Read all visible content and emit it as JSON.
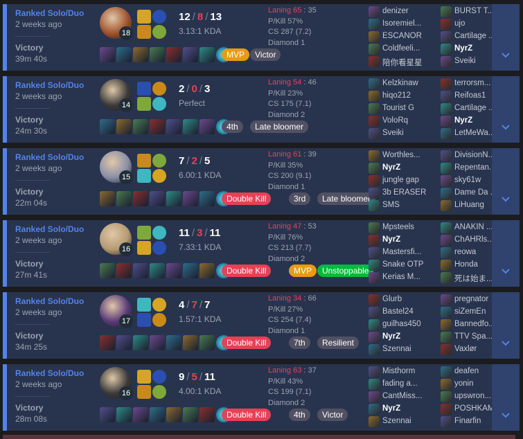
{
  "matches": [
    {
      "mode": "Ranked Solo/Duo",
      "ago": "2 weeks ago",
      "result": "Victory",
      "duration": "39m 40s",
      "level": "18",
      "kills": "12",
      "deaths": "8",
      "assists": "13",
      "ratio": "3.13:1 KDA",
      "laning_label": "Laning",
      "laning_a": "65",
      "laning_b": "35",
      "pkill": "P/Kill 57%",
      "cs": "CS 287 (7.2)",
      "rank": "Diamond 1",
      "badges": [
        {
          "label": "MVP",
          "style": "mvp"
        },
        {
          "label": "Victor",
          "style": "gray"
        }
      ],
      "team1": [
        "denizer",
        "Isoremiel...",
        "ESCANOR",
        "Coldfeeli...",
        "陪你看星星"
      ],
      "team2": [
        "BURST T...",
        "ujo",
        "Cartilage ...",
        "NyrZ",
        "Sveiki"
      ],
      "me_team": 2,
      "me_index": 3,
      "champ_color": "#a0522d"
    },
    {
      "mode": "Ranked Solo/Duo",
      "ago": "2 weeks ago",
      "result": "Victory",
      "duration": "24m 30s",
      "level": "14",
      "kills": "2",
      "deaths": "0",
      "assists": "3",
      "ratio": "Perfect",
      "laning_label": "Laning",
      "laning_a": "54",
      "laning_b": "46",
      "pkill": "P/Kill 23%",
      "cs": "CS 175 (7.1)",
      "rank": "Diamond 2",
      "badges": [
        {
          "label": "4th",
          "style": "gray"
        },
        {
          "label": "Late bloomer",
          "style": "gray"
        }
      ],
      "team1": [
        "Kelzkinaw",
        "hiqo212",
        "Tourist G",
        "VoloRq",
        "Sveiki"
      ],
      "team2": [
        "terrorsm...",
        "Reifoas1",
        "Cartilage ...",
        "NyrZ",
        "LetMeWa..."
      ],
      "me_team": 2,
      "me_index": 3,
      "champ_color": "#3a3a3a"
    },
    {
      "mode": "Ranked Solo/Duo",
      "ago": "2 weeks ago",
      "result": "Victory",
      "duration": "22m 04s",
      "level": "15",
      "kills": "7",
      "deaths": "2",
      "assists": "5",
      "ratio": "6.00:1 KDA",
      "laning_label": "Laning",
      "laning_a": "61",
      "laning_b": "39",
      "pkill": "P/Kill 35%",
      "cs": "CS 200 (9.1)",
      "rank": "Diamond 1",
      "badges": [
        {
          "label": "Double Kill",
          "style": "red"
        },
        {
          "label": "3rd",
          "style": "gray"
        },
        {
          "label": "Late bloomer",
          "style": "gray"
        }
      ],
      "team1": [
        "Worthles...",
        "NyrZ",
        "jungle gap",
        "3b ERASER",
        "SMS"
      ],
      "team2": [
        "DivisionN...",
        "Repentan...",
        "sky61w",
        "Dame Da ...",
        "LiHuang"
      ],
      "me_team": 1,
      "me_index": 1,
      "champ_color": "#8a8fa8"
    },
    {
      "mode": "Ranked Solo/Duo",
      "ago": "2 weeks ago",
      "result": "Victory",
      "duration": "27m 41s",
      "level": "16",
      "kills": "11",
      "deaths": "3",
      "assists": "11",
      "ratio": "7.33:1 KDA",
      "laning_label": "Laning",
      "laning_a": "47",
      "laning_b": "53",
      "pkill": "P/Kill 76%",
      "cs": "CS 213 (7.7)",
      "rank": "Diamond 2",
      "badges": [
        {
          "label": "Double Kill",
          "style": "red"
        },
        {
          "label": "MVP",
          "style": "mvp"
        },
        {
          "label": "Unstoppable",
          "style": "green"
        }
      ],
      "team1": [
        "Mpsteels",
        "NyrZ",
        "Mastersfi...",
        "Snake OTP",
        "Kerias M..."
      ],
      "team2": [
        "ANAKIN ...",
        "ChAHRls...",
        "reowa",
        "Honda",
        "死は始ま..."
      ],
      "me_team": 1,
      "me_index": 1,
      "champ_color": "#b59a72"
    },
    {
      "mode": "Ranked Solo/Duo",
      "ago": "2 weeks ago",
      "result": "Victory",
      "duration": "34m 25s",
      "level": "17",
      "kills": "4",
      "deaths": "7",
      "assists": "7",
      "ratio": "1.57:1 KDA",
      "laning_label": "Laning",
      "laning_a": "34",
      "laning_b": "66",
      "pkill": "P/Kill 27%",
      "cs": "CS 254 (7.4)",
      "rank": "Diamond 1",
      "badges": [
        {
          "label": "Double Kill",
          "style": "red"
        },
        {
          "label": "7th",
          "style": "gray"
        },
        {
          "label": "Resilient",
          "style": "gray"
        }
      ],
      "team1": [
        "Glurb",
        "Bastel24",
        "guilhas450",
        "NyrZ",
        "Szennai"
      ],
      "team2": [
        "pregnator",
        "siZemEn",
        "Bannedfo...",
        "TTV Spa...",
        "Vaxlør"
      ],
      "me_team": 1,
      "me_index": 3,
      "champ_color": "#5a3a78"
    },
    {
      "mode": "Ranked Solo/Duo",
      "ago": "2 weeks ago",
      "result": "Victory",
      "duration": "28m 08s",
      "level": "16",
      "kills": "9",
      "deaths": "5",
      "assists": "11",
      "ratio": "4.00:1 KDA",
      "laning_label": "Laning",
      "laning_a": "63",
      "laning_b": "37",
      "pkill": "P/Kill 43%",
      "cs": "CS 199 (7.1)",
      "rank": "Diamond 2",
      "badges": [
        {
          "label": "Double Kill",
          "style": "red"
        },
        {
          "label": "4th",
          "style": "gray"
        },
        {
          "label": "Victor",
          "style": "gray"
        }
      ],
      "team1": [
        "Misthorm",
        "fading a...",
        "CantMiss...",
        "NyrZ",
        "Szennai"
      ],
      "team2": [
        "deafen",
        "yonin",
        "upswron...",
        "POSHKAM",
        "Finarfin"
      ],
      "me_team": 1,
      "me_index": 3,
      "champ_color": "#3a3a3a"
    }
  ],
  "colors": {
    "accent": "#5383e8",
    "row_bg": "#28344e",
    "expand_bg": "#2f436e",
    "deaths": "#e84057",
    "mvp": "#e89b14",
    "green": "#00bb3b"
  },
  "icons": {
    "expand": "chevron-down-icon"
  }
}
